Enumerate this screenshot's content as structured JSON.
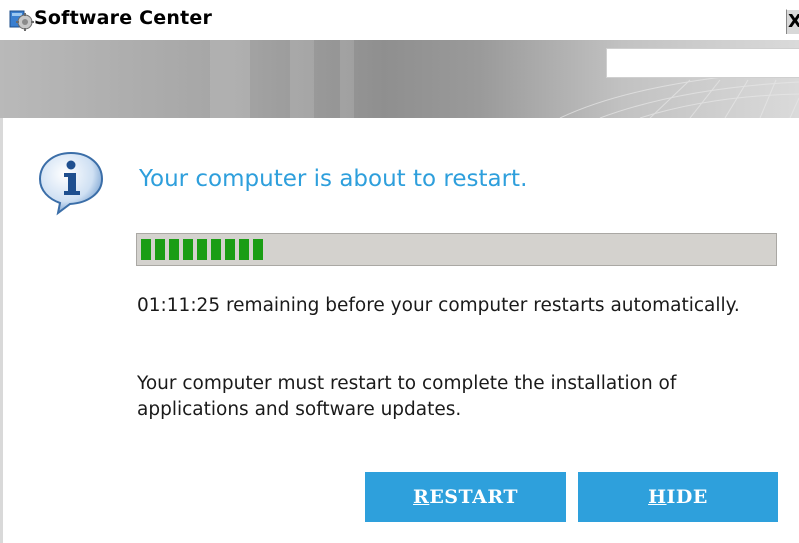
{
  "window": {
    "title": "Software Center",
    "close_label": "X",
    "icon": "software-center-icon"
  },
  "dialog": {
    "icon": "info-balloon-icon",
    "headline": "Your computer is about to restart.",
    "progress": {
      "fraction": 0.2,
      "color": "#1a9d14"
    },
    "countdown_message": "01:11:25 remaining before your computer restarts automatically.",
    "reason_message": "Your computer must restart to complete the installation of applications and software updates.",
    "restart_mnemonic": "R",
    "restart_rest": "ESTART",
    "hide_mnemonic": "H",
    "hide_rest": "IDE"
  },
  "colors": {
    "accent": "#2ea0dc",
    "button_text": "#ffffff",
    "progress_track": "#d4d2ce"
  }
}
